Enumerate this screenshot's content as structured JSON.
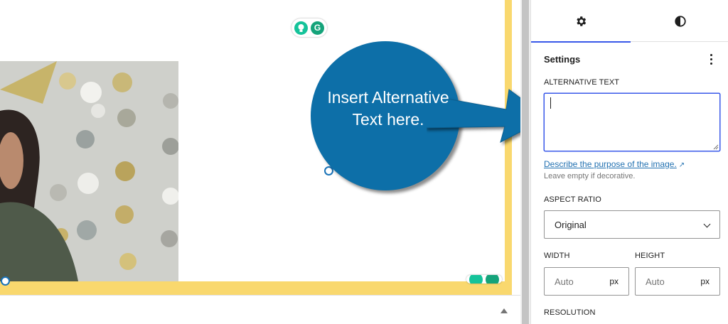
{
  "sidebar": {
    "tabs": [
      {
        "name": "settings",
        "icon": "gear-icon",
        "active": true
      },
      {
        "name": "styles",
        "icon": "half-circle-icon",
        "active": false
      }
    ],
    "panel_title": "Settings",
    "alt_text": {
      "label": "ALTERNATIVE TEXT",
      "value": "",
      "link_text": "Describe the purpose of the image.",
      "help_text": "Leave empty if decorative."
    },
    "aspect_ratio": {
      "label": "ASPECT RATIO",
      "selected": "Original"
    },
    "width": {
      "label": "WIDTH",
      "placeholder": "Auto",
      "unit": "px"
    },
    "height": {
      "label": "HEIGHT",
      "placeholder": "Auto",
      "unit": "px"
    },
    "resolution": {
      "label": "RESOLUTION"
    }
  },
  "callout": {
    "text_line1": "Insert Alternative",
    "text_line2": "Text here."
  },
  "colors": {
    "accent": "#3858e9",
    "frame_yellow": "#f9d86e",
    "callout_blue": "#0d6fa8",
    "link_blue": "#2271b1",
    "grammarly_green": "#15c39a"
  }
}
